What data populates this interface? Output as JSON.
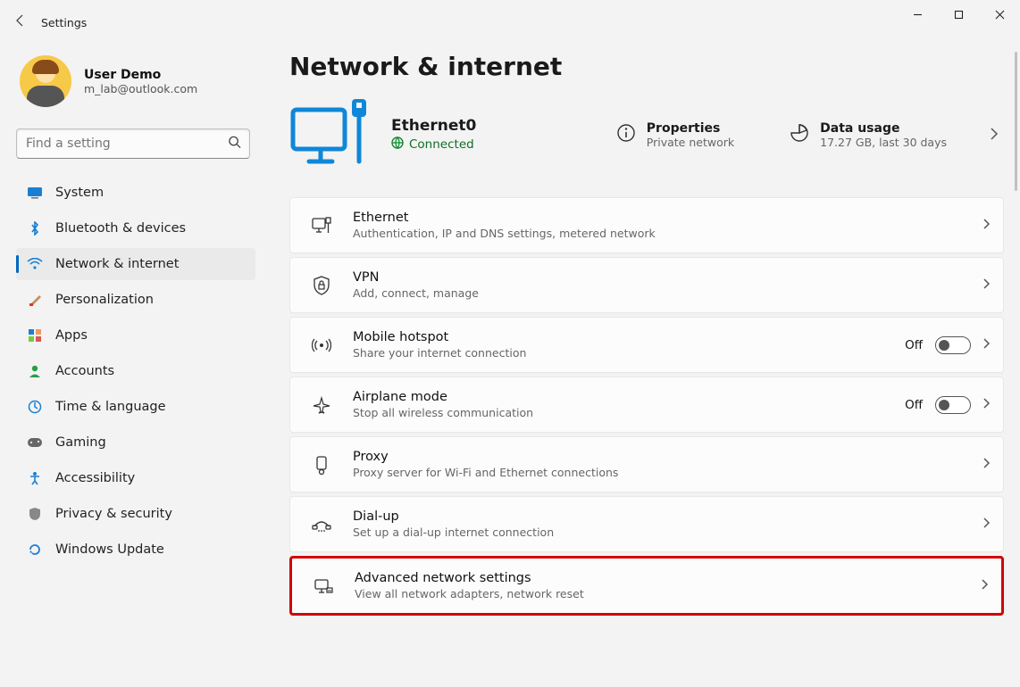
{
  "title": "Settings",
  "account": {
    "name": "User Demo",
    "email": "m_lab@outlook.com"
  },
  "search": {
    "placeholder": "Find a setting"
  },
  "nav": [
    {
      "label": "System"
    },
    {
      "label": "Bluetooth & devices"
    },
    {
      "label": "Network & internet"
    },
    {
      "label": "Personalization"
    },
    {
      "label": "Apps"
    },
    {
      "label": "Accounts"
    },
    {
      "label": "Time & language"
    },
    {
      "label": "Gaming"
    },
    {
      "label": "Accessibility"
    },
    {
      "label": "Privacy & security"
    },
    {
      "label": "Windows Update"
    }
  ],
  "page": {
    "heading": "Network & internet",
    "adapter": {
      "name": "Ethernet0",
      "status": "Connected"
    },
    "stats": {
      "properties": {
        "title": "Properties",
        "sub": "Private network"
      },
      "usage": {
        "title": "Data usage",
        "sub": "17.27 GB, last 30 days"
      }
    }
  },
  "cards": {
    "ethernet": {
      "title": "Ethernet",
      "sub": "Authentication, IP and DNS settings, metered network"
    },
    "vpn": {
      "title": "VPN",
      "sub": "Add, connect, manage"
    },
    "hotspot": {
      "title": "Mobile hotspot",
      "sub": "Share your internet connection",
      "state": "Off"
    },
    "airplane": {
      "title": "Airplane mode",
      "sub": "Stop all wireless communication",
      "state": "Off"
    },
    "proxy": {
      "title": "Proxy",
      "sub": "Proxy server for Wi-Fi and Ethernet connections"
    },
    "dialup": {
      "title": "Dial-up",
      "sub": "Set up a dial-up internet connection"
    },
    "advanced": {
      "title": "Advanced network settings",
      "sub": "View all network adapters, network reset"
    }
  }
}
